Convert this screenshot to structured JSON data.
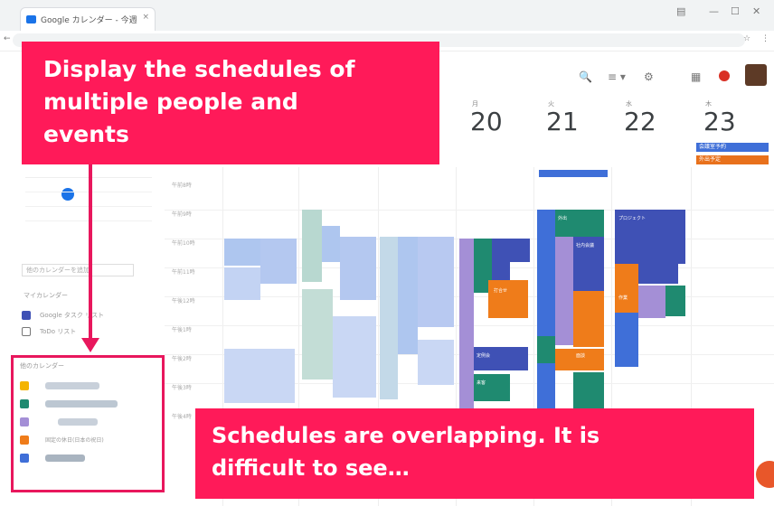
{
  "browser": {
    "tab_title": "Google カレンダー - 今週",
    "tab_close": "×",
    "window_controls": [
      "▤",
      "—",
      "☐",
      "✕"
    ],
    "address_icons": [
      "←",
      "☆",
      "⋮"
    ]
  },
  "toolbar": {
    "search": "🔍",
    "view": "≡ ▾",
    "settings": "⚙",
    "apps": "▦"
  },
  "week": {
    "days": [
      {
        "dow": "月",
        "date": "20"
      },
      {
        "dow": "火",
        "date": "21"
      },
      {
        "dow": "水",
        "date": "22"
      },
      {
        "dow": "木",
        "date": "23"
      }
    ],
    "allday": [
      "会議室予約",
      "外出予定"
    ]
  },
  "sidebar": {
    "search_placeholder": "他のカレンダーを追加",
    "my_calendars_label": "マイカレンダー",
    "my_calendars": [
      "Google タスク リスト",
      "ToDo リスト"
    ],
    "other_label": "他のカレンダー",
    "other_text": "固定の休日(日本の祝日)"
  },
  "times": [
    "午前8時",
    "午前9時",
    "午前10時",
    "午前11時",
    "午後12時",
    "午後1時",
    "午後2時",
    "午後3時",
    "午後4時"
  ],
  "event_labels": [
    "打合せ",
    "定例会",
    "来客",
    "外出",
    "社内会議",
    "面談",
    "プロジェクト",
    "作業"
  ],
  "callouts": {
    "top_line1": "Display the schedules of",
    "top_line2": "multiple people and",
    "top_line3": "events",
    "bottom_line1": "Schedules are overlapping. It is",
    "bottom_line2": "difficult to see…"
  },
  "colors": {
    "callout": "#ff1a59",
    "highlight": "#e8175d",
    "calendar_blue": "#1a73e8"
  }
}
